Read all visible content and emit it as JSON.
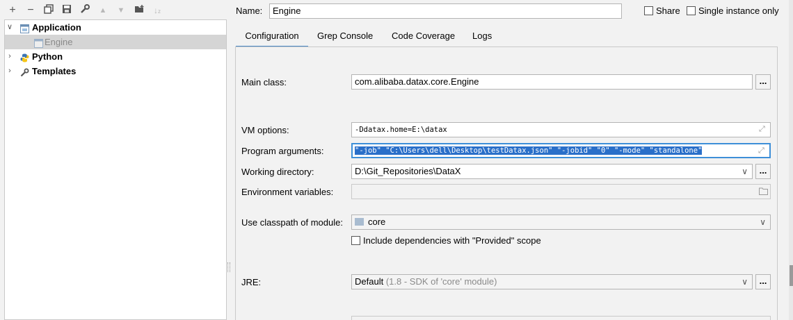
{
  "toolbar": {
    "icons": [
      "add-icon",
      "remove-icon",
      "copy-icon",
      "save-icon",
      "wrench-icon",
      "move-up-icon",
      "move-down-icon",
      "new-folder-icon",
      "sort-icon"
    ]
  },
  "tree": {
    "application": "Application",
    "engine": "Engine",
    "python": "Python",
    "templates": "Templates"
  },
  "header": {
    "name_label": "Name:",
    "name_value": "Engine",
    "share_label": "Share",
    "single_instance_label": "Single instance only"
  },
  "tabs": [
    "Configuration",
    "Grep Console",
    "Code Coverage",
    "Logs"
  ],
  "form": {
    "main_class_label": "Main class:",
    "main_class_value": "com.alibaba.datax.core.Engine",
    "vm_options_label": "VM options:",
    "vm_options_value": "-Ddatax.home=E:\\datax",
    "program_args_label": "Program arguments:",
    "program_args_value": "\"-job\" \"C:\\Users\\dell\\Desktop\\testDatax.json\" \"-jobid\" \"0\" \"-mode\" \"standalone\"",
    "working_dir_label": "Working directory:",
    "working_dir_value": "D:\\Git_Repositories\\DataX",
    "env_vars_label": "Environment variables:",
    "env_vars_value": "",
    "classpath_label": "Use classpath of module:",
    "classpath_value": "core",
    "include_deps_label": "Include dependencies with \"Provided\" scope",
    "jre_label": "JRE:",
    "jre_value": "Default",
    "jre_hint": "(1.8 - SDK of 'core' module)",
    "browse": "..."
  }
}
